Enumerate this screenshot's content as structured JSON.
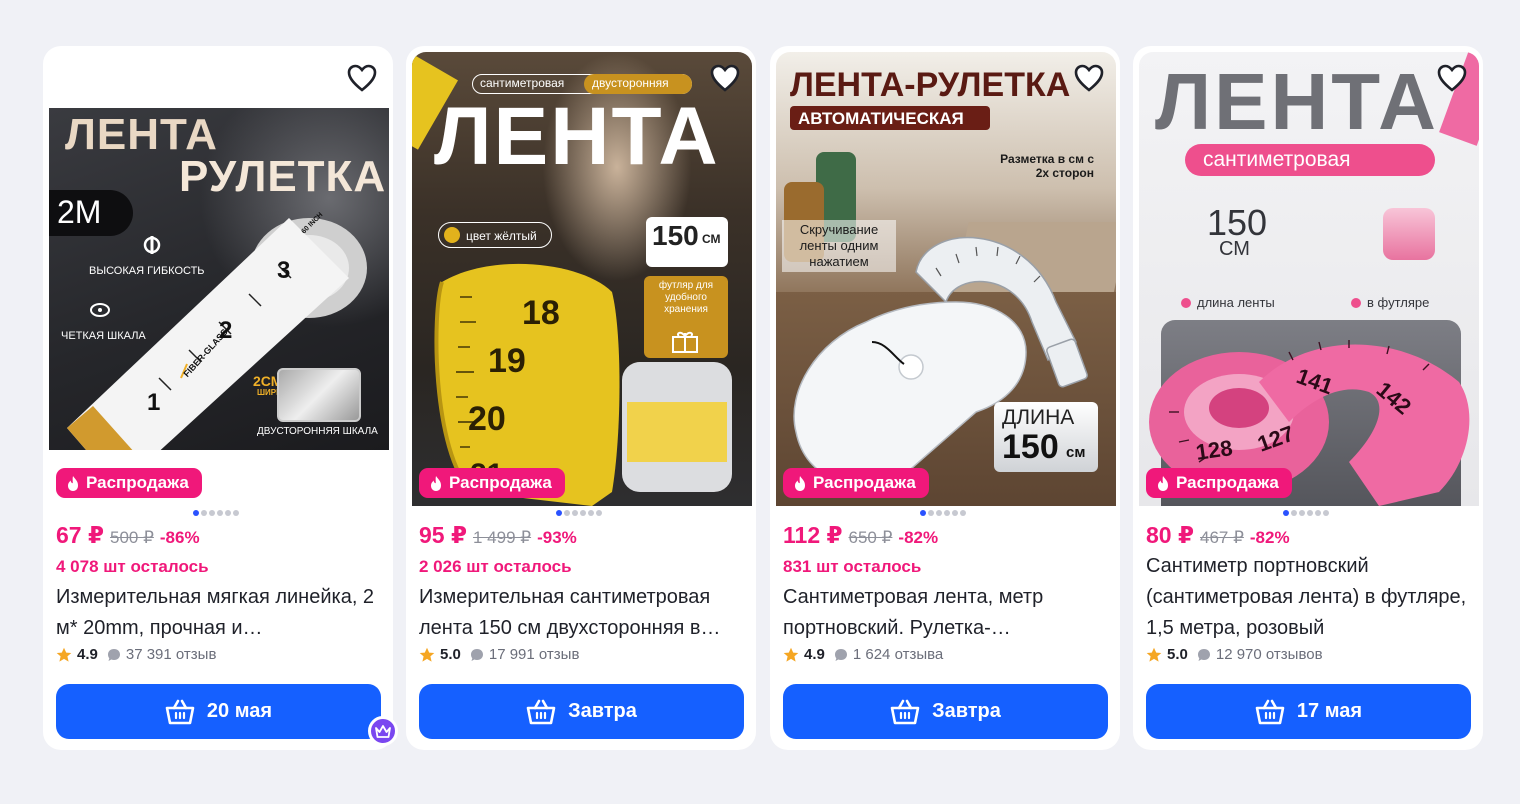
{
  "products": [
    {
      "art": {
        "line1": "ЛЕНТА",
        "line2": "РУЛЕТКА",
        "size": "2М",
        "feature1": "ВЫСОКАЯ ГИБКОСТЬ",
        "feature2": "ЧЕТКАЯ ШКАЛА",
        "width_value": "2СМ",
        "width_label": "ШИРИН",
        "double_side": "ДВУСТОРОННЯЯ ШКАЛА",
        "tape_mark": "FIBER-GLASS",
        "tape_inch": "60 INCH"
      },
      "badge": "Распродажа",
      "price": "67 ₽",
      "old_price": "500 ₽",
      "discount": "-86%",
      "stock": "4 078 шт осталось",
      "title": "Измерительная мягкая линейка, 2 м* 20mm, прочная и…",
      "rating": "4.9",
      "reviews": "37 391 отзыв",
      "delivery": "20 мая"
    },
    {
      "art": {
        "tag1": "сантиметровая",
        "tag2": "двусторонняя",
        "headline": "ЛЕНТА",
        "color": "цвет жёлтый",
        "length": "150",
        "length_unit": "СМ",
        "case": "футляр для удобного хранения",
        "n18": "18",
        "n19": "19",
        "n20": "20",
        "n21": "21"
      },
      "badge": "Распродажа",
      "price": "95 ₽",
      "old_price": "1 499 ₽",
      "discount": "-93%",
      "stock": "2 026 шт осталось",
      "title": "Измерительная сантиметровая лента 150 см двухсторонняя в…",
      "rating": "5.0",
      "reviews": "17 991 отзыв",
      "delivery": "Завтра"
    },
    {
      "art": {
        "headline": "ЛЕНТА-РУЛЕТКА",
        "sub": "АВТОМАТИЧЕСКАЯ",
        "marks": "Разметка в см с 2х сторон",
        "twist": "Скручивание ленты одним нажатием",
        "len_label": "ДЛИНА",
        "len_value": "150",
        "len_unit": "см"
      },
      "badge": "Распродажа",
      "price": "112 ₽",
      "old_price": "650 ₽",
      "discount": "-82%",
      "stock": "831 шт осталось",
      "title": "Сантиметровая лента, метр портновский. Рулетка-…",
      "rating": "4.9",
      "reviews": "1 624 отзыва",
      "delivery": "Завтра"
    },
    {
      "art": {
        "headline": "ЛЕНТА",
        "sub": "сантиметровая",
        "len_value": "150",
        "len_unit": "СМ",
        "feat1": "длина ленты",
        "feat2": "в футляре",
        "n128": "128",
        "n127": "127",
        "n141": "141",
        "n142": "142"
      },
      "badge": "Распродажа",
      "price": "80 ₽",
      "old_price": "467 ₽",
      "discount": "-82%",
      "stock": "",
      "title": "Сантиметр портновский (сантиметровая лента) в футляре, 1,5 метра, розовый",
      "rating": "5.0",
      "reviews": "12 970 отзывов",
      "delivery": "17 мая"
    }
  ],
  "colors": {
    "accent_pink": "#f0187a",
    "button_blue": "#1560ff",
    "dot_active": "#2a52ff",
    "star": "#f5a623",
    "crown_badge": "#7a47f0"
  },
  "icons": [
    "heart-icon",
    "fire-icon",
    "star-icon",
    "comment-icon",
    "basket-icon",
    "crown-icon"
  ]
}
